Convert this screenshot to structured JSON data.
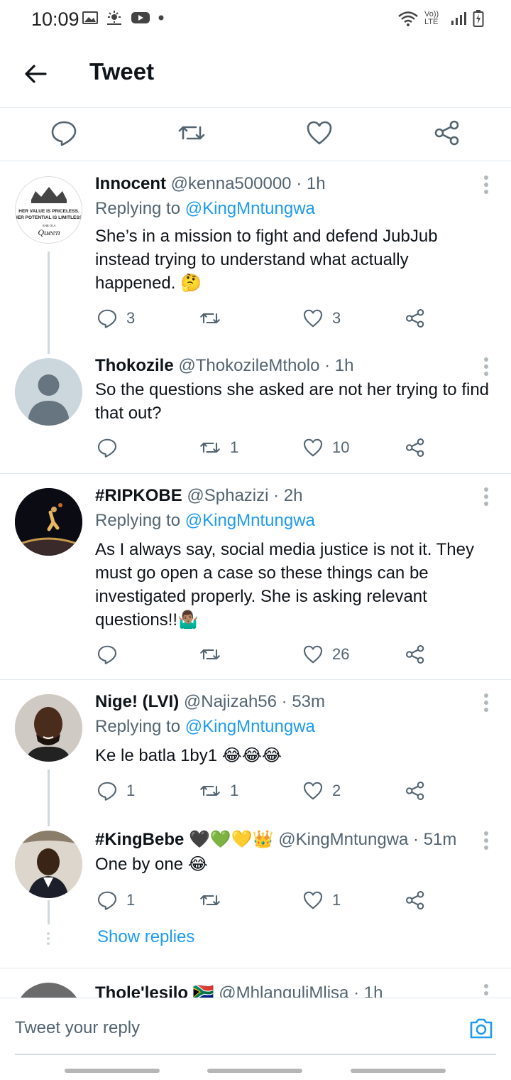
{
  "status_bar": {
    "time": "10:09",
    "network_label": "Vo)) LTE"
  },
  "app_bar": {
    "title": "Tweet"
  },
  "colors": {
    "accent": "#1d9bf0",
    "text_primary": "#0f1419",
    "text_secondary": "#536471"
  },
  "tweets": [
    {
      "name": "Innocent",
      "handle": "@kenna500000",
      "time": "· 1h",
      "replying_prefix": "Replying to",
      "replying_to": "@KingMntungwa",
      "text": "She’s in a mission to fight and defend JubJub instead trying to understand what actually happened. 🤔",
      "replies": "3",
      "retweets": "",
      "likes": "3",
      "avatar_text": "HER VALUE IS PRICELESS. HER POTENTIAL IS LIMITLESS. SHE IS A Queen"
    },
    {
      "name": "Thokozile",
      "handle": "@ThokozileMtholo",
      "time": "· 1h",
      "text": "So the questions she asked are not her trying to find that out?",
      "replies": "",
      "retweets": "1",
      "likes": "10"
    },
    {
      "name": "#RIPKOBE",
      "handle": "@Sphazizi",
      "time": "· 2h",
      "replying_prefix": "Replying to",
      "replying_to": "@KingMntungwa",
      "text": "As I always say, social media justice is not it. They must go open a case so these things can be investigated properly. She is asking relevant questions!!🤷🏽‍♂️",
      "replies": "",
      "retweets": "",
      "likes": "26"
    },
    {
      "name": "Nige! (LVI)",
      "handle": "@Najizah56",
      "time": "· 53m",
      "replying_prefix": "Replying to",
      "replying_to": "@KingMntungwa",
      "text": "Ke le batla 1by1 😂😂😂",
      "replies": "1",
      "retweets": "1",
      "likes": "2"
    },
    {
      "name": "#KingBebe 🖤💚💛👑",
      "handle": "@KingMntungwa",
      "time": "· 51m",
      "text": "One by one 😂",
      "replies": "1",
      "retweets": "",
      "likes": "1"
    },
    {
      "name": "Thole'lesilo 🇿🇦",
      "handle": "@MhlanguliMlisa",
      "time": "· 1h"
    }
  ],
  "show_replies_label": "Show replies",
  "reply_bar": {
    "placeholder": "Tweet your reply"
  }
}
